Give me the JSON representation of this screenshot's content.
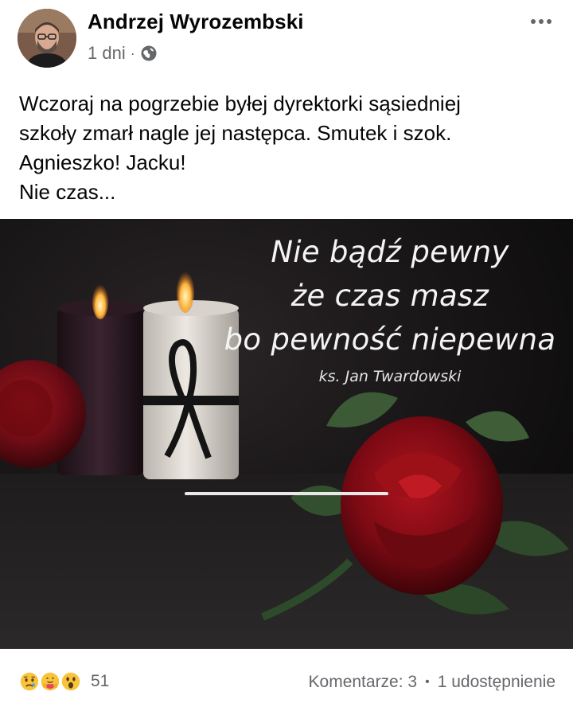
{
  "post": {
    "author": "Andrzej Wyrozembski",
    "time": "1 dni",
    "separator": "·",
    "privacy_icon": "globe-icon",
    "text_lines": [
      "Wczoraj na pogrzebie byłej dyrektorki sąsiedniej",
      "szkoły zmarł nagle jej następca. Smutek i szok.",
      "Agnieszko! Jacku!",
      "Nie czas..."
    ]
  },
  "image": {
    "quote_lines": [
      "Nie bądź pewny",
      "że czas masz",
      "bo pewność niepewna"
    ],
    "quote_author": "ks. Jan Twardowski"
  },
  "footer": {
    "reaction_icons": [
      "sad-reaction-icon",
      "care-reaction-icon",
      "wow-reaction-icon"
    ],
    "reaction_count": "51",
    "comments": "Komentarze: 3",
    "dot": "•",
    "shares": "1 udostępnienie"
  },
  "colors": {
    "text": "#050505",
    "secondary": "#65676b",
    "emoji_yellow": "#f7c43b",
    "care_red": "#e9445a"
  }
}
